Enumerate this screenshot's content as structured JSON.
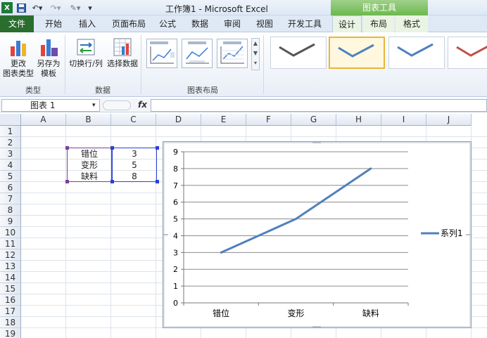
{
  "title_bar": {
    "title": "工作簿1 - Microsoft Excel",
    "chart_tools": "图表工具"
  },
  "tabs": [
    {
      "label": "文件"
    },
    {
      "label": "开始"
    },
    {
      "label": "插入"
    },
    {
      "label": "页面布局"
    },
    {
      "label": "公式"
    },
    {
      "label": "数据"
    },
    {
      "label": "审阅"
    },
    {
      "label": "视图"
    },
    {
      "label": "开发工具"
    },
    {
      "label": "设计"
    },
    {
      "label": "布局"
    },
    {
      "label": "格式"
    }
  ],
  "ribbon": {
    "type_group": {
      "label": "类型",
      "change_type_line1": "更改",
      "change_type_line2": "图表类型",
      "save_template_line1": "另存为",
      "save_template_line2": "模板"
    },
    "data_group": {
      "label": "数据",
      "switch_row_col": "切换行/列",
      "select_data": "选择数据"
    },
    "layout_group": {
      "label": "图表布局"
    },
    "style_colors": [
      "#555555",
      "#4f81bd",
      "#4f81bd",
      "#c0504d"
    ]
  },
  "formula_bar": {
    "name_box": "图表 1",
    "fx": "fx"
  },
  "columns": [
    "A",
    "B",
    "C",
    "D",
    "E",
    "F",
    "G",
    "H",
    "I",
    "J"
  ],
  "rows": [
    "1",
    "2",
    "3",
    "4",
    "5",
    "6",
    "7",
    "8",
    "9",
    "10",
    "11",
    "12",
    "13",
    "14",
    "15",
    "16",
    "17",
    "18",
    "19"
  ],
  "cells": [
    {
      "label": "错位",
      "value": "3"
    },
    {
      "label": "变形",
      "value": "5"
    },
    {
      "label": "缺料",
      "value": "8"
    }
  ],
  "chart_data": {
    "type": "line",
    "categories": [
      "错位",
      "变形",
      "缺料"
    ],
    "series": [
      {
        "name": "系列1",
        "values": [
          3,
          5,
          8
        ],
        "color": "#4f81bd"
      }
    ],
    "ylim": [
      0,
      9
    ],
    "yticks": [
      "0",
      "1",
      "2",
      "3",
      "4",
      "5",
      "6",
      "7",
      "8",
      "9"
    ],
    "grid": true,
    "legend": "right",
    "title": "",
    "xlabel": "",
    "ylabel": ""
  }
}
